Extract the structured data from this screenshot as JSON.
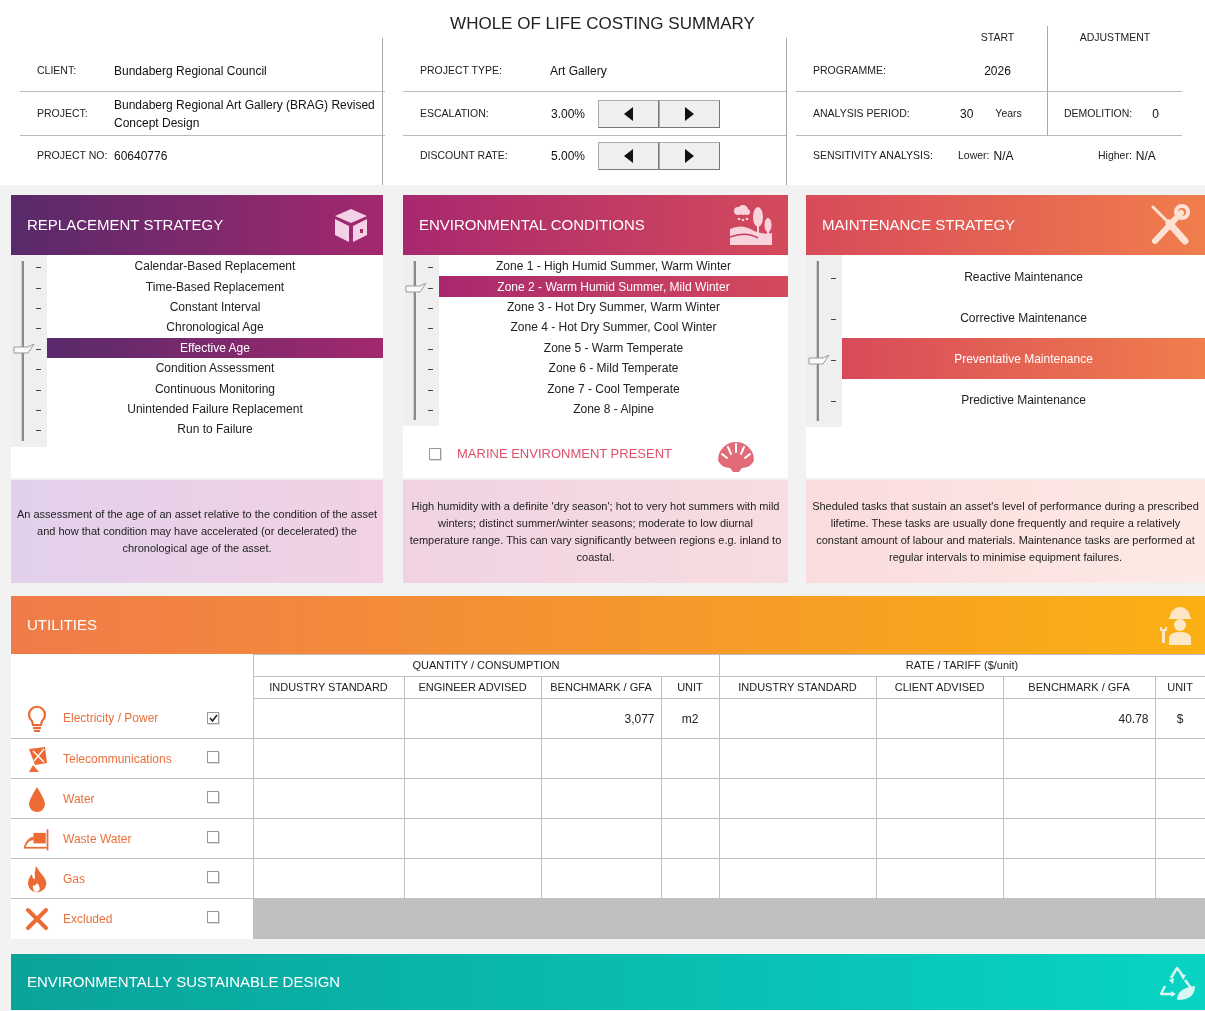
{
  "title": "WHOLE OF LIFE COSTING SUMMARY",
  "project": [
    {
      "label": "CLIENT:",
      "value": "Bundaberg Regional Council"
    },
    {
      "label": "PROJECT:",
      "value": "Bundaberg Regional Art Gallery (BRAG) Revised Concept Design"
    },
    {
      "label": "PROJECT NO:",
      "value": "60640776"
    }
  ],
  "parameters": [
    {
      "kind": "text",
      "label": "PROJECT TYPE:",
      "value": "Art Gallery"
    },
    {
      "kind": "stepper",
      "label": "ESCALATION:",
      "value": "3.00%"
    },
    {
      "kind": "stepper",
      "label": "DISCOUNT RATE:",
      "value": "5.00%"
    }
  ],
  "programme": {
    "start_heading": "START",
    "adjustment_heading": "ADJUSTMENT",
    "programme_label": "PROGRAMME:",
    "start": "2026",
    "analysis_label": "ANALYSIS PERIOD:",
    "analysis_value": "30",
    "analysis_unit": "Years",
    "demolition_label": "DEMOLITION:",
    "demolition_value": "0",
    "sensitivity_label": "SENSITIVITY ANALYSIS:",
    "lower_label": "Lower:",
    "lower_value": "N/A",
    "higher_label": "Higher:",
    "higher_value": "N/A"
  },
  "panels": [
    {
      "title": "REPLACEMENT STRATEGY",
      "options": [
        {
          "label": "Calendar-Based Replacement",
          "selected": false
        },
        {
          "label": "Time-Based Replacement",
          "selected": false
        },
        {
          "label": "Constant Interval",
          "selected": false
        },
        {
          "label": "Chronological Age",
          "selected": false
        },
        {
          "label": "Effective Age",
          "selected": true
        },
        {
          "label": "Condition Assessment",
          "selected": false
        },
        {
          "label": "Continuous Monitoring",
          "selected": false
        },
        {
          "label": "Unintended Failure Replacement",
          "selected": false
        },
        {
          "label": "Run to Failure",
          "selected": false
        }
      ],
      "description": "An assessment of the age of an asset relative to the condition of the asset and how that condition may have accelerated (or decelerated) the chronological age of the asset."
    },
    {
      "title": "ENVIRONMENTAL CONDITIONS",
      "options": [
        {
          "label": "Zone 1 - High Humid Summer, Warm Winter",
          "selected": false
        },
        {
          "label": "Zone 2 - Warm Humid Summer, Mild Winter",
          "selected": true
        },
        {
          "label": "Zone 3 - Hot Dry Summer, Warm Winter",
          "selected": false
        },
        {
          "label": "Zone 4 - Hot Dry Summer, Cool Winter",
          "selected": false
        },
        {
          "label": "Zone 5 - Warm Temperate",
          "selected": false
        },
        {
          "label": "Zone 6 - Mild Temperate",
          "selected": false
        },
        {
          "label": "Zone 7 - Cool Temperate",
          "selected": false
        },
        {
          "label": "Zone 8 - Alpine",
          "selected": false
        }
      ],
      "marine": {
        "label": "MARINE ENVIRONMENT PRESENT",
        "checked": false
      },
      "description": "High humidity with a definite 'dry season'; hot to very hot summers with mild winters; distinct summer/winter seasons; moderate to low diurnal temperature range. This can vary significantly between regions e.g. inland to coastal."
    },
    {
      "title": "MAINTENANCE STRATEGY",
      "options": [
        {
          "label": "Reactive Maintenance",
          "selected": false
        },
        {
          "label": "Corrective Maintenance",
          "selected": false
        },
        {
          "label": "Preventative Maintenance",
          "selected": true
        },
        {
          "label": "Predictive Maintenance",
          "selected": false
        }
      ],
      "description": "Sheduled tasks that sustain an asset's level of performance during a prescribed lifetime. These tasks are usually done frequently and require a relatively constant amount of labour and materials. Maintenance tasks are performed at regular intervals to minimise equipment failures."
    }
  ],
  "utilities": {
    "title": "UTILITIES",
    "groups": [
      {
        "label": "QUANTITY / CONSUMPTION",
        "columns": [
          "INDUSTRY STANDARD",
          "ENGINEER ADVISED",
          "BENCHMARK / GFA",
          "UNIT"
        ]
      },
      {
        "label": "RATE / TARIFF ($/unit)",
        "columns": [
          "INDUSTRY STANDARD",
          "CLIENT ADVISED",
          "BENCHMARK / GFA",
          "UNIT"
        ]
      }
    ],
    "rows": [
      {
        "kind": "utility",
        "label": "Electricity / Power",
        "checked": true,
        "quantity": {
          "benchmark": "3,077",
          "unit": "m2"
        },
        "rate": {
          "benchmark": "40.78",
          "unit": "$"
        }
      },
      {
        "kind": "utility",
        "label": "Telecommunications",
        "checked": false
      },
      {
        "kind": "utility",
        "label": "Water",
        "checked": false
      },
      {
        "kind": "utility",
        "label": "Waste Water",
        "checked": false
      },
      {
        "kind": "utility",
        "label": "Gas",
        "checked": false
      },
      {
        "kind": "excluded",
        "label": "Excluded",
        "checked": false
      }
    ]
  },
  "esd": {
    "title": "ENVIRONMENTALLY SUSTAINABLE DESIGN"
  }
}
